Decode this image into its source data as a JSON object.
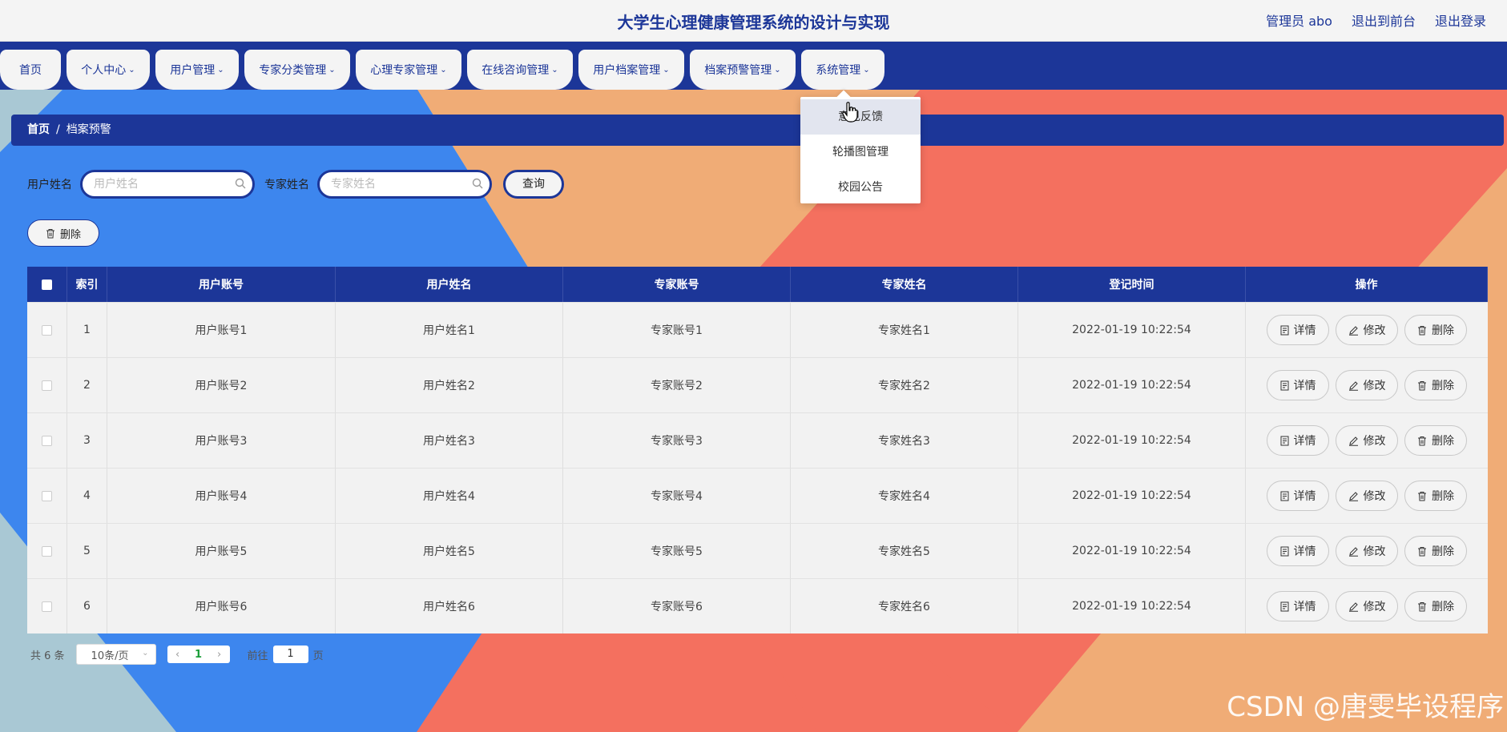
{
  "header": {
    "title": "大学生心理健康管理系统的设计与实现",
    "user_label": "管理员 abo",
    "front_label": "退出到前台",
    "logout_label": "退出登录"
  },
  "nav": {
    "tabs": [
      {
        "label": "首页"
      },
      {
        "label": "个人中心"
      },
      {
        "label": "用户管理"
      },
      {
        "label": "专家分类管理"
      },
      {
        "label": "心理专家管理"
      },
      {
        "label": "在线咨询管理"
      },
      {
        "label": "用户档案管理"
      },
      {
        "label": "档案预警管理"
      },
      {
        "label": "系统管理"
      }
    ]
  },
  "dropdown": {
    "items": [
      {
        "label": "意见反馈"
      },
      {
        "label": "轮播图管理"
      },
      {
        "label": "校园公告"
      }
    ]
  },
  "breadcrumb": {
    "home": "首页",
    "sep": "/",
    "current": "档案预警"
  },
  "search": {
    "user_label": "用户姓名",
    "user_placeholder": "用户姓名",
    "expert_label": "专家姓名",
    "expert_placeholder": "专家姓名",
    "query_label": "查询"
  },
  "actions": {
    "delete_label": "删除"
  },
  "table": {
    "headers": [
      "索引",
      "用户账号",
      "用户姓名",
      "专家账号",
      "专家姓名",
      "登记时间",
      "操作"
    ],
    "rows": [
      {
        "index": "1",
        "user_account": "用户账号1",
        "user_name": "用户姓名1",
        "expert_account": "专家账号1",
        "expert_name": "专家姓名1",
        "time": "2022-01-19 10:22:54"
      },
      {
        "index": "2",
        "user_account": "用户账号2",
        "user_name": "用户姓名2",
        "expert_account": "专家账号2",
        "expert_name": "专家姓名2",
        "time": "2022-01-19 10:22:54"
      },
      {
        "index": "3",
        "user_account": "用户账号3",
        "user_name": "用户姓名3",
        "expert_account": "专家账号3",
        "expert_name": "专家姓名3",
        "time": "2022-01-19 10:22:54"
      },
      {
        "index": "4",
        "user_account": "用户账号4",
        "user_name": "用户姓名4",
        "expert_account": "专家账号4",
        "expert_name": "专家姓名4",
        "time": "2022-01-19 10:22:54"
      },
      {
        "index": "5",
        "user_account": "用户账号5",
        "user_name": "用户姓名5",
        "expert_account": "专家账号5",
        "expert_name": "专家姓名5",
        "time": "2022-01-19 10:22:54"
      },
      {
        "index": "6",
        "user_account": "用户账号6",
        "user_name": "用户姓名6",
        "expert_account": "专家账号6",
        "expert_name": "专家姓名6",
        "time": "2022-01-19 10:22:54"
      }
    ],
    "detail_label": "详情",
    "edit_label": "修改",
    "delete_label": "删除"
  },
  "pager": {
    "total": "共 6 条",
    "page_size": "10条/页",
    "current_page": "1",
    "goto_label": "前往",
    "goto_value": "1",
    "page_suffix": "页"
  },
  "watermark": "CSDN @唐雯毕设程序",
  "colors": {
    "primary": "#1c3698",
    "bg_blue": "#3d86ee",
    "bg_orange": "#f0ac76",
    "bg_red": "#f4705f",
    "bg_teal": "#a9c8d4"
  }
}
